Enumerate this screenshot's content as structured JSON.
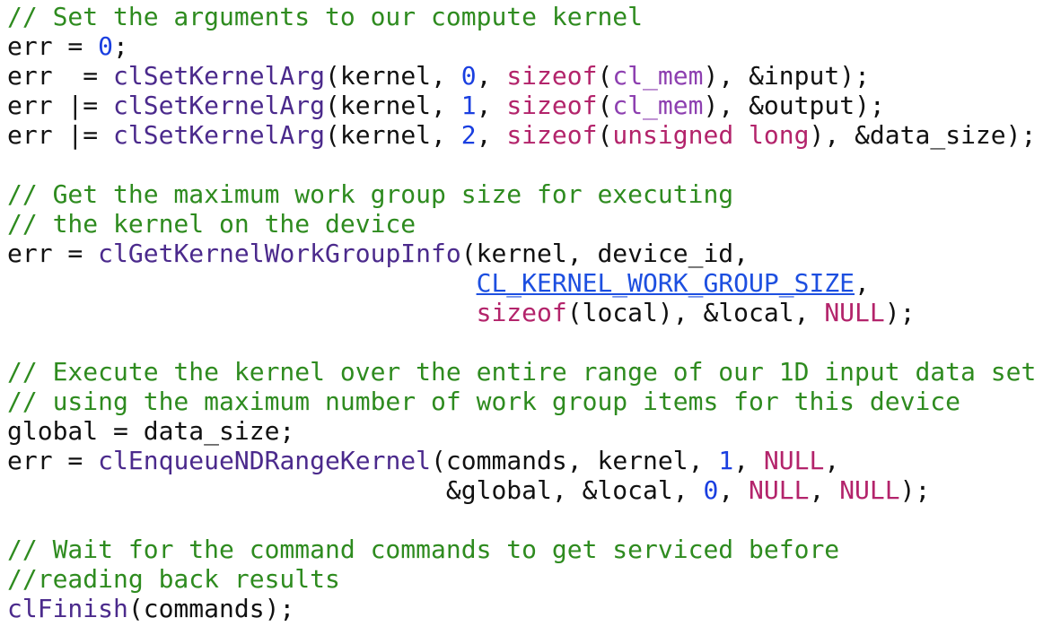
{
  "colors": {
    "background": "#ffffff",
    "text": "#111111",
    "comment": "#2e8b1f",
    "function": "#4b2a8c",
    "keyword": "#b3246b",
    "type": "#8d3fb0",
    "number": "#1a3fe0",
    "link": "#1d4fe0"
  },
  "lines": [
    [
      {
        "t": "// Set the arguments to our compute kernel",
        "k": "comment"
      }
    ],
    [
      {
        "t": "err = "
      },
      {
        "t": "0",
        "k": "num"
      },
      {
        "t": ";"
      }
    ],
    [
      {
        "t": "err  = "
      },
      {
        "t": "clSetKernelArg",
        "k": "func"
      },
      {
        "t": "(kernel, "
      },
      {
        "t": "0",
        "k": "num"
      },
      {
        "t": ", "
      },
      {
        "t": "sizeof",
        "k": "kw"
      },
      {
        "t": "("
      },
      {
        "t": "cl_mem",
        "k": "type"
      },
      {
        "t": "), &input);"
      }
    ],
    [
      {
        "t": "err |= "
      },
      {
        "t": "clSetKernelArg",
        "k": "func"
      },
      {
        "t": "(kernel, "
      },
      {
        "t": "1",
        "k": "num"
      },
      {
        "t": ", "
      },
      {
        "t": "sizeof",
        "k": "kw"
      },
      {
        "t": "("
      },
      {
        "t": "cl_mem",
        "k": "type"
      },
      {
        "t": "), &output);"
      }
    ],
    [
      {
        "t": "err |= "
      },
      {
        "t": "clSetKernelArg",
        "k": "func"
      },
      {
        "t": "(kernel, "
      },
      {
        "t": "2",
        "k": "num"
      },
      {
        "t": ", "
      },
      {
        "t": "sizeof",
        "k": "kw"
      },
      {
        "t": "("
      },
      {
        "t": "unsigned long",
        "k": "kw"
      },
      {
        "t": "), &data_size);"
      }
    ],
    [],
    [
      {
        "t": "// Get the maximum work group size for executing",
        "k": "comment"
      }
    ],
    [
      {
        "t": "// the kernel on the device",
        "k": "comment"
      }
    ],
    [
      {
        "t": "err = "
      },
      {
        "t": "clGetKernelWorkGroupInfo",
        "k": "func"
      },
      {
        "t": "(kernel, device_id,"
      }
    ],
    [
      {
        "t": "                               "
      },
      {
        "t": "CL_KERNEL_WORK_GROUP_SIZE",
        "k": "link"
      },
      {
        "t": ","
      }
    ],
    [
      {
        "t": "                               "
      },
      {
        "t": "sizeof",
        "k": "kw"
      },
      {
        "t": "(local), &local, "
      },
      {
        "t": "NULL",
        "k": "const"
      },
      {
        "t": ");"
      }
    ],
    [],
    [
      {
        "t": "// Execute the kernel over the entire range of our 1D input data set",
        "k": "comment"
      }
    ],
    [
      {
        "t": "// using the maximum number of work group items for this device",
        "k": "comment"
      }
    ],
    [
      {
        "t": "global = data_size;"
      }
    ],
    [
      {
        "t": "err = "
      },
      {
        "t": "clEnqueueNDRangeKernel",
        "k": "func"
      },
      {
        "t": "(commands, kernel, "
      },
      {
        "t": "1",
        "k": "num"
      },
      {
        "t": ", "
      },
      {
        "t": "NULL",
        "k": "const"
      },
      {
        "t": ","
      }
    ],
    [
      {
        "t": "                             &global, &local, "
      },
      {
        "t": "0",
        "k": "num"
      },
      {
        "t": ", "
      },
      {
        "t": "NULL",
        "k": "const"
      },
      {
        "t": ", "
      },
      {
        "t": "NULL",
        "k": "const"
      },
      {
        "t": ");"
      }
    ],
    [],
    [
      {
        "t": "// Wait for the command commands to get serviced before",
        "k": "comment"
      }
    ],
    [
      {
        "t": "//reading back results",
        "k": "comment"
      }
    ],
    [
      {
        "t": "clFinish",
        "k": "func"
      },
      {
        "t": "(commands);"
      }
    ]
  ]
}
